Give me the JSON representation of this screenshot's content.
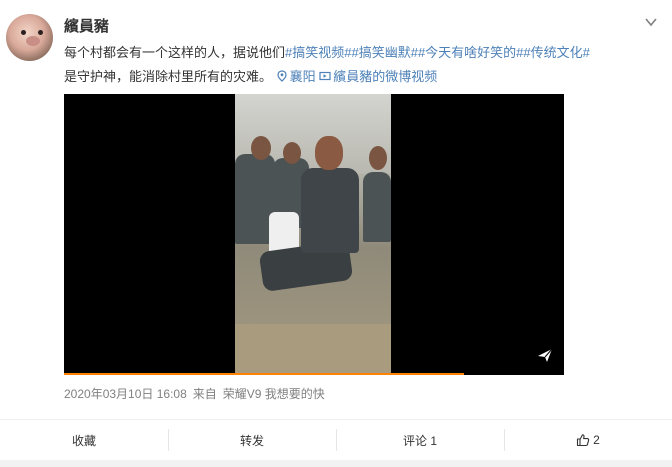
{
  "post": {
    "username": "繽員豬",
    "text_intro": "每个村都会有一个这样的人，据说他们",
    "hashtags": [
      "#搞笑视频#",
      "#搞笑幽默#",
      "#今天有啥好笑的#",
      "#传统文化#"
    ],
    "text_rest": "是守护神，能消除村里所有的灾难。",
    "location_label": "襄阳",
    "video_link_label": "繽員豬的微博视频",
    "timestamp": "2020年03月10日 16:08",
    "source_prefix": "来自",
    "source_device": "荣耀V9 我想要的快"
  },
  "icons": {
    "menu": "chevron-down-icon",
    "location": "location-pin-icon",
    "video_link": "video-icon",
    "player": "paper-plane-icon",
    "like": "thumbs-up-icon"
  },
  "video": {
    "progress_fraction": 0.8
  },
  "toolbar": {
    "favorite_label": "收藏",
    "repost_label": "转发",
    "comment_label": "评论 1",
    "like_count": "2"
  },
  "colors": {
    "accent_link": "#4d81b8",
    "progress": "#ff8200",
    "text_primary": "#333333",
    "text_meta": "#808080"
  }
}
